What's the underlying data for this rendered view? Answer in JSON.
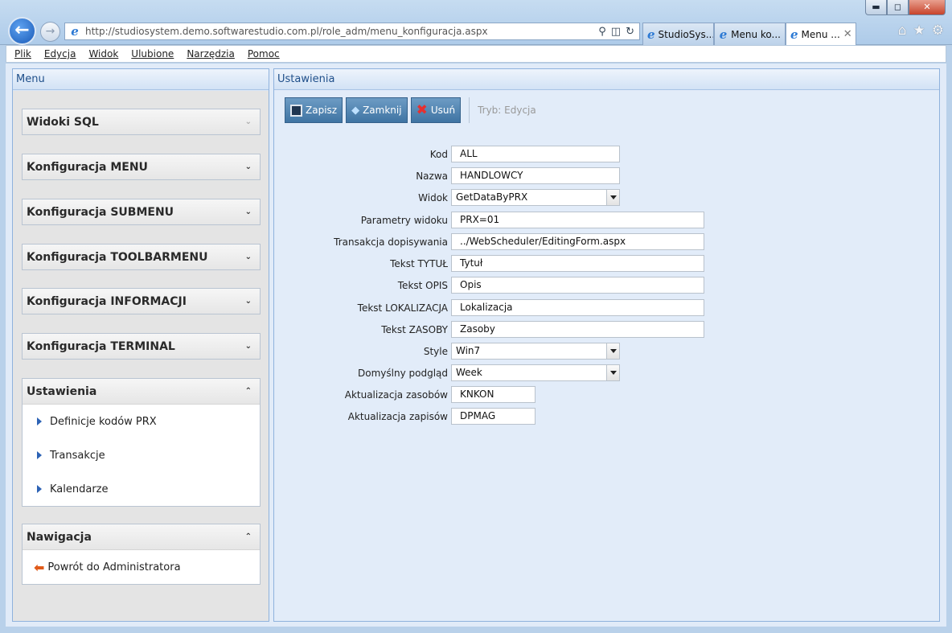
{
  "window": {
    "min": "▬",
    "max": "◻",
    "close": "✕"
  },
  "address": {
    "url": "http://studiosystem.demo.softwarestudio.com.pl/role_adm/menu_konfiguracja.aspx"
  },
  "tabs": [
    {
      "label": "StudioSys..."
    },
    {
      "label": "Menu ko..."
    },
    {
      "label": "Menu ..."
    }
  ],
  "menubar": [
    "Plik",
    "Edycja",
    "Widok",
    "Ulubione",
    "Narzędzia",
    "Pomoc"
  ],
  "left_panel": {
    "title": "Menu",
    "sections": [
      {
        "title": "Widoki SQL"
      },
      {
        "title": "Konfiguracja MENU"
      },
      {
        "title": "Konfiguracja SUBMENU"
      },
      {
        "title": "Konfiguracja TOOLBARMENU"
      },
      {
        "title": "Konfiguracja INFORMACJI"
      },
      {
        "title": "Konfiguracja TERMINAL"
      }
    ],
    "ustawienia": {
      "title": "Ustawienia",
      "items": [
        "Definicje kodów PRX",
        "Transakcje",
        "Kalendarze"
      ]
    },
    "nawigacja": {
      "title": "Nawigacja",
      "items": [
        "Powrót do Administratora"
      ]
    }
  },
  "right_panel": {
    "title": "Ustawienia",
    "toolbar": {
      "save": "Zapisz",
      "close": "Zamknij",
      "delete": "Usuń",
      "mode": "Tryb: Edycja"
    },
    "form": [
      {
        "label": "Kod",
        "value": "ALL"
      },
      {
        "label": "Nazwa",
        "value": "HANDLOWCY"
      },
      {
        "label": "Widok",
        "value": "GetDataByPRX"
      },
      {
        "label": "Parametry widoku",
        "value": "PRX=01"
      },
      {
        "label": "Transakcja dopisywania",
        "value": "../WebScheduler/EditingForm.aspx"
      },
      {
        "label": "Tekst TYTUŁ",
        "value": "Tytuł"
      },
      {
        "label": "Tekst OPIS",
        "value": "Opis"
      },
      {
        "label": "Tekst LOKALIZACJA",
        "value": "Lokalizacja"
      },
      {
        "label": "Tekst ZASOBY",
        "value": "Zasoby"
      },
      {
        "label": "Style",
        "value": "Win7"
      },
      {
        "label": "Domyślny podgląd",
        "value": "Week"
      },
      {
        "label": "Aktualizacja zasobów",
        "value": "KNKON"
      },
      {
        "label": "Aktualizacja zapisów",
        "value": "DPMAG"
      }
    ]
  }
}
